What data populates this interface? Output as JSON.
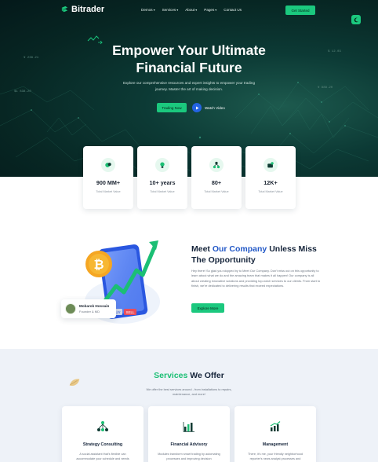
{
  "nav": {
    "logo": "Bitrader",
    "menu": [
      {
        "label": "Demos",
        "has_dropdown": true
      },
      {
        "label": "Services",
        "has_dropdown": true
      },
      {
        "label": "About",
        "has_dropdown": true
      },
      {
        "label": "Pages",
        "has_dropdown": true
      },
      {
        "label": "Contact Us",
        "has_dropdown": false
      }
    ],
    "cta": "Get Started"
  },
  "hero": {
    "title_line1": "Empower Your Ultimate",
    "title_line2": "Financial Future",
    "subtitle": "Explore our comprehensive resources and expert insights to empower your trading journey. Master the art of making decision.",
    "primary_button": "Trading Now",
    "video_button": "Watch Video",
    "bg_numbers": [
      "¥ 238.21",
      "$1 838.20",
      "¥ 888.20",
      "$ 12.03"
    ]
  },
  "stats": [
    {
      "value": "900 MM+",
      "label": "Total Market Value",
      "icon": "coins-icon"
    },
    {
      "value": "10+ years",
      "label": "Total Market Value",
      "icon": "lightbulb-icon"
    },
    {
      "value": "80+",
      "label": "Total Market Value",
      "icon": "network-icon"
    },
    {
      "value": "12K+",
      "label": "Total Market Value",
      "icon": "wallet-users-icon"
    }
  ],
  "about": {
    "title_prefix": "Meet ",
    "title_accent": "Our Company",
    "title_suffix": " Unless Miss The Opportunity",
    "text": "Hey there! So glad you stopped by to Meet Our Company. Don't miss out on this opportunity to learn about what we do and the amazing team that makes it all happen! Our company is all about creating innovative solutions and providing top-notch services to our clients. From start to finish, we're dedicated to delivering results that exceed expectations.",
    "button": "Explore More",
    "profile_name": "Mobarok Hossain",
    "profile_role": "Founder & MD",
    "phone_buy": "BUY",
    "phone_sell": "SELL"
  },
  "services": {
    "title_accent": "Services",
    "title_rest": " We Offer",
    "subtitle": "We offer the best services around - from installations to repairs, maintenance, and more!",
    "items": [
      {
        "name": "Strategy Consulting",
        "desc": "A social assistant that's flexible can accommodate your schedule and needs",
        "icon": "network-nodes-icon"
      },
      {
        "name": "Financial Advisory",
        "desc": "Modules transform smart trading by automating processes and improving decision",
        "icon": "bar-chart-icon"
      },
      {
        "name": "Management",
        "desc": "There, it's me, your friendly neighborhood reporter's news analyst processes and",
        "icon": "growth-chart-icon"
      }
    ]
  },
  "colors": {
    "accent_green": "#1bc87e",
    "accent_blue": "#2258c7",
    "hero_dark": "#072623"
  }
}
